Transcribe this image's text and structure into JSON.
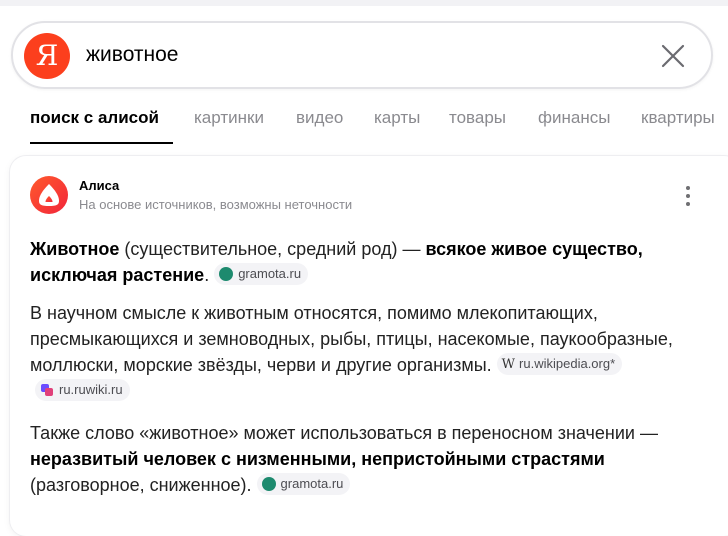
{
  "search": {
    "logo_letter": "Я",
    "query": "животное"
  },
  "tabs": [
    {
      "label": "поиск с алисой",
      "active": true
    },
    {
      "label": "картинки"
    },
    {
      "label": "видео"
    },
    {
      "label": "карты"
    },
    {
      "label": "товары"
    },
    {
      "label": "финансы"
    },
    {
      "label": "квартиры"
    }
  ],
  "answer": {
    "author": "Алиса",
    "disclaimer": "На основе источников, возможны неточности",
    "p1": {
      "term": "Животное",
      "grammar": " (существительное, средний род) — ",
      "definition": "всякое живое существо, исключая растение",
      "end": ".",
      "source": "gramota.ru"
    },
    "p2": {
      "text": "В научном смысле к животным относятся, помимо млекопитающих, пресмыкающихся и земноводных, рыбы, птицы, насекомые, паукообразные, моллюски, морские звёзды, черви и другие организмы.",
      "source1": "ru.wikipedia.org*",
      "source2": "ru.ruwiki.ru"
    },
    "p3": {
      "start": "Также слово «животное» может использоваться в переносном значении — ",
      "definition": "неразвитый человек с низменными, непристойными страстями",
      "end": " (разговорное, сниженное).",
      "source": "gramota.ru"
    }
  },
  "colors": {
    "brand": "#fc3f1d",
    "alice_gradient": [
      "#ff5a2c",
      "#f2253b"
    ],
    "source_gramota": "#1d8a6e",
    "ruwiki": [
      "#6a4cff",
      "#e0407a"
    ]
  }
}
